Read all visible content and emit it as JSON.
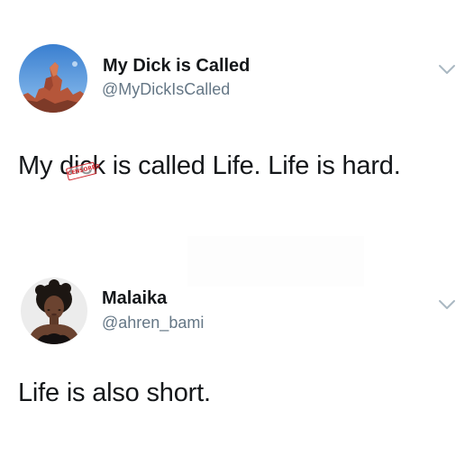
{
  "tweets": [
    {
      "display_name": "My Dick is Called",
      "handle": "@MyDickIsCalled",
      "text_before": "My ",
      "censored_word": "dick",
      "censored_stamp": "CENSORED",
      "text_after": " is called Life. Life is hard.",
      "avatar_icon": "rock-formation-avatar",
      "menu_icon": "chevron-down-icon"
    },
    {
      "display_name": "Malaika",
      "handle": "@ahren_bami",
      "text": "Life is also short.",
      "avatar_icon": "woman-portrait-avatar",
      "menu_icon": "chevron-down-icon"
    }
  ],
  "colors": {
    "text": "#14171a",
    "handle": "#657786",
    "censored": "#d0262d",
    "chevron": "#aab8c2"
  }
}
